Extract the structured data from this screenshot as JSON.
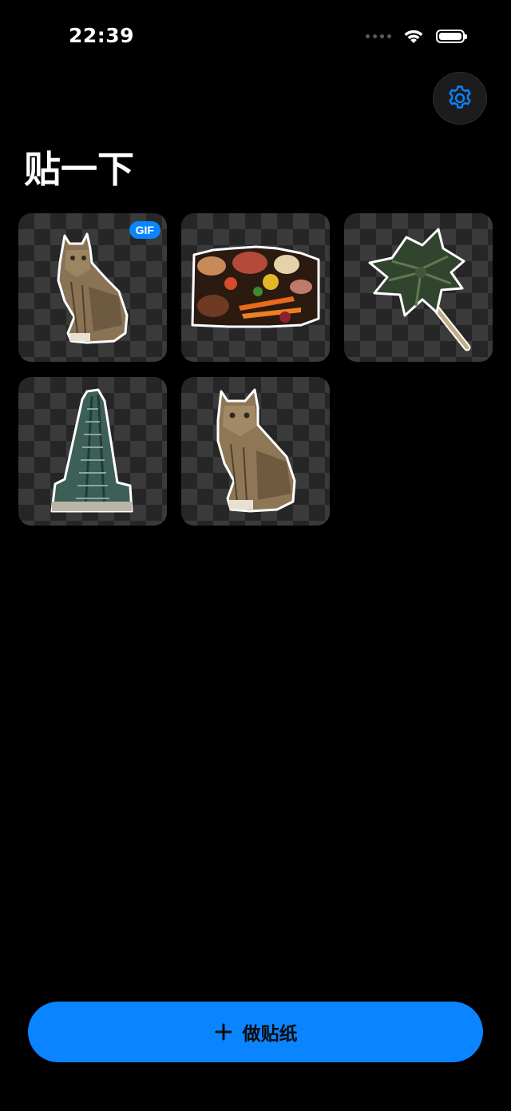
{
  "status_bar": {
    "time": "22:39",
    "battery_level": 1.0
  },
  "header": {
    "title": "贴一下",
    "settings_icon": "gear-icon"
  },
  "stickers": [
    {
      "subject": "cat",
      "badge": "GIF"
    },
    {
      "subject": "food"
    },
    {
      "subject": "palm-tree"
    },
    {
      "subject": "skyscraper"
    },
    {
      "subject": "cat"
    }
  ],
  "footer": {
    "make_button_icon": "plus-icon",
    "make_button_label": "做贴纸"
  },
  "colors": {
    "background": "#000000",
    "accent": "#0a84ff",
    "card_checker_dark": "#262626",
    "card_checker_light": "#3a3a3a"
  }
}
